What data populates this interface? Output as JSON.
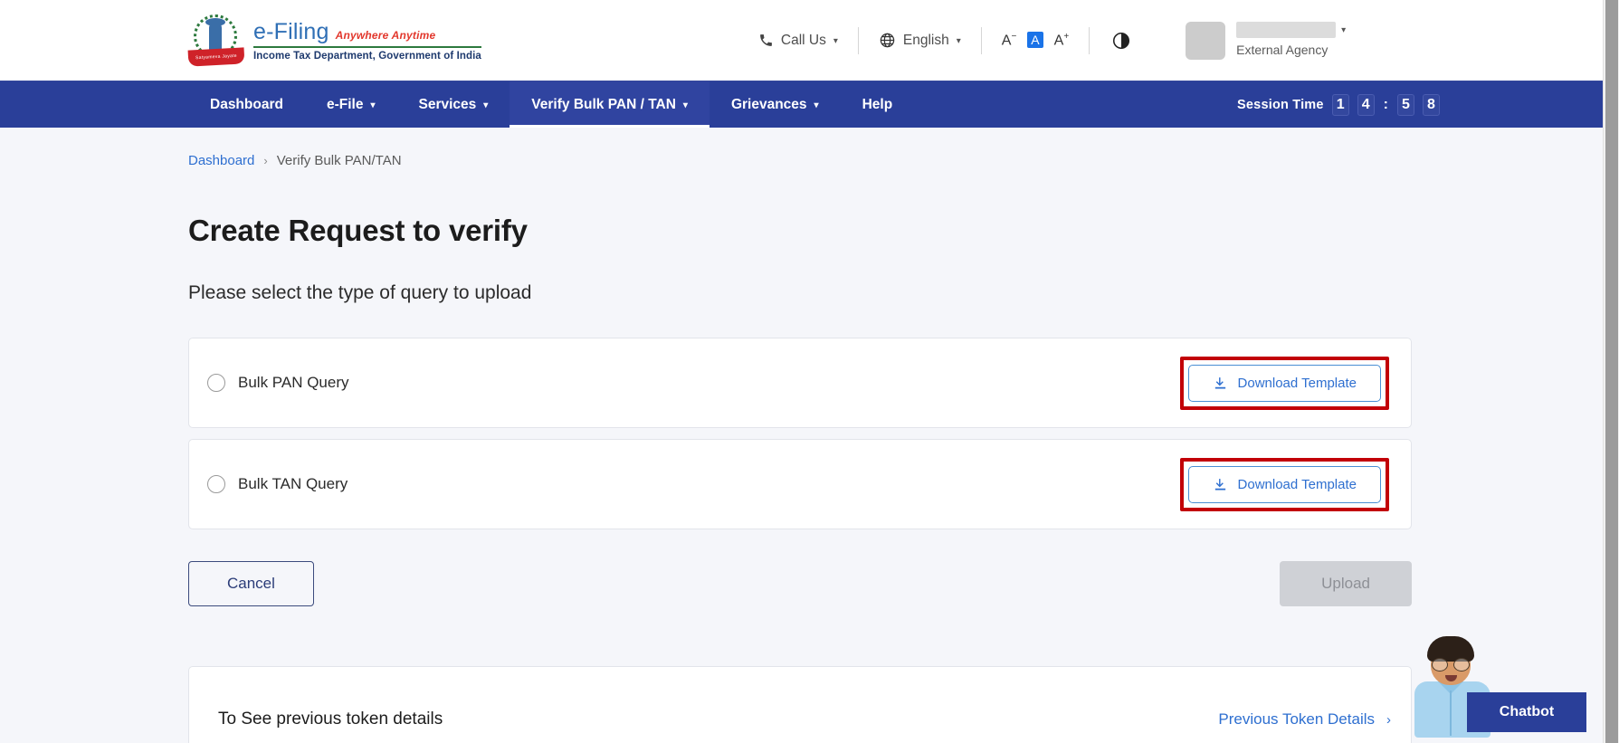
{
  "header": {
    "logo": {
      "emblem_label": "india-emblem",
      "satyameva": "Satyameva Jayate",
      "title": "e-Filing",
      "tagline": "Anywhere Anytime",
      "department": "Income Tax Department, Government of India"
    },
    "tools": {
      "call_us": "Call Us",
      "language": "English",
      "font_decrease": "A",
      "font_normal": "A",
      "font_increase": "A",
      "contrast_icon": "contrast-icon"
    },
    "user": {
      "name": "",
      "role": "External Agency"
    }
  },
  "nav": {
    "items": [
      {
        "label": "Dashboard",
        "has_caret": false,
        "active": false
      },
      {
        "label": "e-File",
        "has_caret": true,
        "active": false
      },
      {
        "label": "Services",
        "has_caret": true,
        "active": false
      },
      {
        "label": "Verify Bulk PAN / TAN",
        "has_caret": true,
        "active": true
      },
      {
        "label": "Grievances",
        "has_caret": true,
        "active": false
      },
      {
        "label": "Help",
        "has_caret": false,
        "active": false
      }
    ],
    "session": {
      "label": "Session Time",
      "d1": "1",
      "d2": "4",
      "colon": ":",
      "d3": "5",
      "d4": "8"
    }
  },
  "breadcrumb": {
    "root": "Dashboard",
    "separator": "›",
    "current": "Verify Bulk PAN/TAN"
  },
  "main": {
    "title": "Create Request to verify",
    "subtitle": "Please select the type of query to upload",
    "options": [
      {
        "label": "Bulk PAN Query",
        "selected": false,
        "download_label": "Download Template",
        "highlighted": true
      },
      {
        "label": "Bulk TAN Query",
        "selected": false,
        "download_label": "Download Template",
        "highlighted": true
      }
    ],
    "actions": {
      "cancel": "Cancel",
      "upload": "Upload",
      "upload_disabled": true
    },
    "token_section": {
      "text": "To See previous token details",
      "link": "Previous Token Details",
      "chevron": "›"
    }
  },
  "chatbot": {
    "label": "Chatbot",
    "avatar": "chatbot-avatar"
  },
  "colors": {
    "nav_blue": "#2a3f99",
    "link_blue": "#2e6fd0",
    "highlight_red": "#c20007",
    "page_bg": "#f5f6fa",
    "accent_green": "#2d7a3e",
    "tagline_red": "#e2372c"
  }
}
